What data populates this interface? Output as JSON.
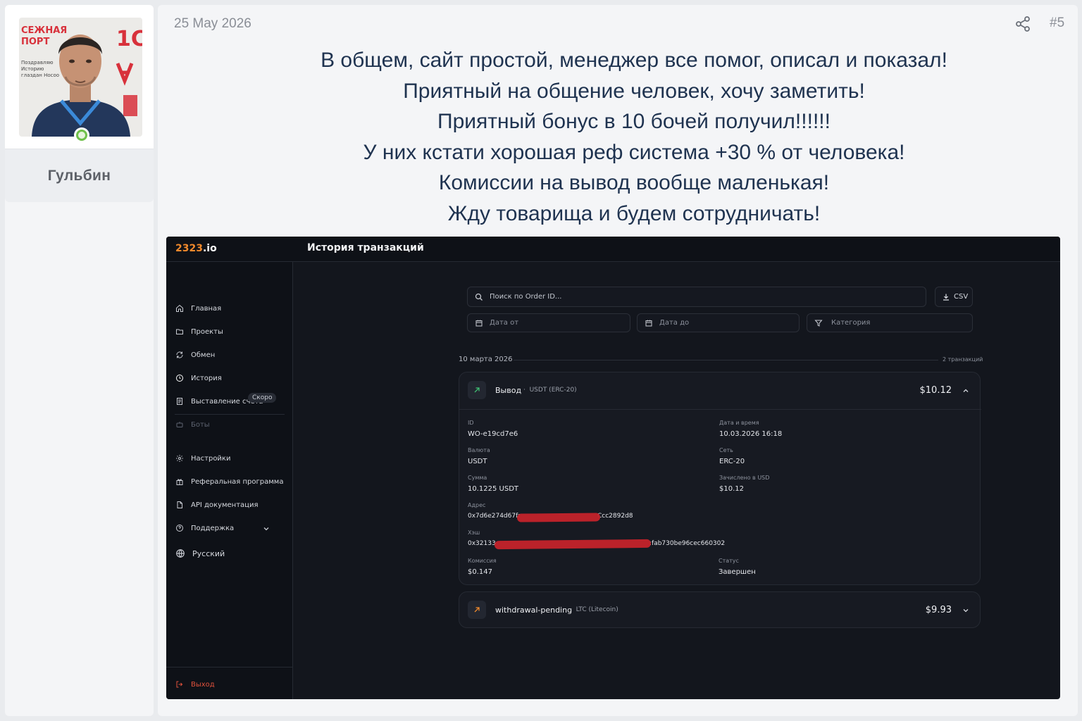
{
  "user": {
    "name": "Гульбин",
    "avatar_backdrop_text": [
      "СЕЖНАЯ",
      "ПОРТ",
      "1С",
      "Поздравляю",
      "Историю",
      "глаздан Носоо"
    ]
  },
  "post": {
    "date": "25 May 2026",
    "number": "#5",
    "lines": [
      "В общем, сайт простой, менеджер все помог, описал и показал!",
      "Приятный на общение человек, хочу заметить!",
      "Приятный бонус в 10 бочей получил!!!!!!",
      "У них кстати хорошая реф система +30 % от человека!",
      "Комиссии на вывод вообще маленькая!",
      "Жду товарища и будем сотрудничать!"
    ]
  },
  "app": {
    "brand_num": "2323",
    "brand_tld": ".io",
    "page_title": "История транзакций",
    "nav": [
      {
        "label": "Главная",
        "icon": "home-icon"
      },
      {
        "label": "Проекты",
        "icon": "folder-icon"
      },
      {
        "label": "Обмен",
        "icon": "exchange-icon"
      },
      {
        "label": "История",
        "icon": "clock-icon"
      },
      {
        "label": "Выставление счета",
        "icon": "invoice-icon"
      },
      {
        "label": "Боты",
        "icon": "bot-icon",
        "badge": "Скоро"
      },
      {
        "label": "Настройки",
        "icon": "gear-icon"
      },
      {
        "label": "Реферальная программа",
        "icon": "referral-icon"
      },
      {
        "label": "API документация",
        "icon": "document-icon"
      },
      {
        "label": "Поддержка",
        "icon": "help-icon"
      },
      {
        "label": "Русский",
        "icon": "globe-icon"
      }
    ],
    "logout": "Выход",
    "search_placeholder": "Поиск по Order ID...",
    "csv_label": "CSV",
    "date_from": "Дата от",
    "date_to": "Дата до",
    "category": "Категория",
    "day_label": "10 марта 2026",
    "day_count": "2 транзакций",
    "transactions": [
      {
        "type": "Вывод",
        "network": "USDT (ERC-20)",
        "amount": "$10.12",
        "icon_color": "#3fbf73",
        "details": {
          "id_label": "ID",
          "id": "WO-e19cd7e6",
          "datetime_label": "Дата и время",
          "datetime": "10.03.2026 16:18",
          "currency_label": "Валюта",
          "currency": "USDT",
          "network_label": "Сеть",
          "network": "ERC-20",
          "sum_label": "Сумма",
          "sum": "10.1225 USDT",
          "credited_label": "Зачислено в USD",
          "credited": "$10.12",
          "address_label": "Адрес",
          "address_start": "0x7d6e274d67fr",
          "address_end": "Ccc2892d8",
          "hash_label": "Хэш",
          "hash_start": "0x32133",
          "hash_end": ":fab730be96cec660302",
          "fee_label": "Комиссия",
          "fee": "$0.147",
          "status_label": "Статус",
          "status": "Завершен"
        }
      },
      {
        "type": "withdrawal-pending",
        "network": "LTC (Litecoin)",
        "amount": "$9.93",
        "icon_color": "#f28a2c"
      }
    ]
  }
}
